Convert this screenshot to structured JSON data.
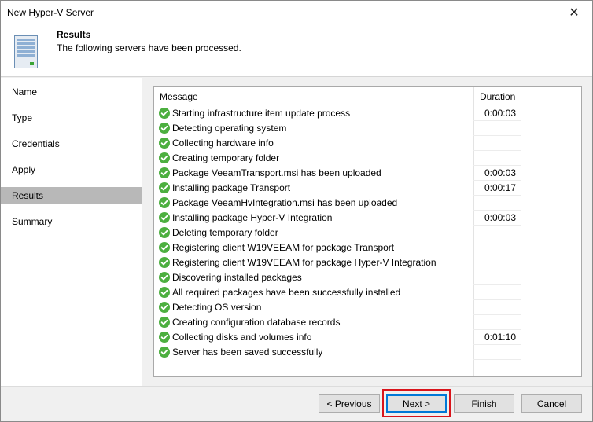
{
  "window": {
    "title": "New Hyper-V Server",
    "close_glyph": "✕"
  },
  "header": {
    "icon": "server-icon",
    "title": "Results",
    "subtitle": "The following servers have been processed."
  },
  "sidebar": {
    "items": [
      {
        "label": "Name",
        "active": false
      },
      {
        "label": "Type",
        "active": false
      },
      {
        "label": "Credentials",
        "active": false
      },
      {
        "label": "Apply",
        "active": false
      },
      {
        "label": "Results",
        "active": true
      },
      {
        "label": "Summary",
        "active": false
      }
    ]
  },
  "table": {
    "headers": {
      "message": "Message",
      "duration": "Duration"
    },
    "status_icon": "check-circle-icon",
    "status_color": "#4caf3f",
    "rows": [
      {
        "message": "Starting infrastructure item update process",
        "duration": "0:00:03"
      },
      {
        "message": "Detecting operating system",
        "duration": ""
      },
      {
        "message": "Collecting hardware info",
        "duration": ""
      },
      {
        "message": "Creating temporary folder",
        "duration": ""
      },
      {
        "message": "Package VeeamTransport.msi has been uploaded",
        "duration": "0:00:03"
      },
      {
        "message": "Installing package Transport",
        "duration": "0:00:17"
      },
      {
        "message": "Package VeeamHvIntegration.msi has been uploaded",
        "duration": ""
      },
      {
        "message": "Installing package Hyper-V Integration",
        "duration": "0:00:03"
      },
      {
        "message": "Deleting temporary folder",
        "duration": ""
      },
      {
        "message": "Registering client W19VEEAM for package Transport",
        "duration": ""
      },
      {
        "message": "Registering client W19VEEAM for package Hyper-V Integration",
        "duration": ""
      },
      {
        "message": "Discovering installed packages",
        "duration": ""
      },
      {
        "message": "All required packages have been successfully installed",
        "duration": ""
      },
      {
        "message": "Detecting OS version",
        "duration": ""
      },
      {
        "message": "Creating configuration database records",
        "duration": ""
      },
      {
        "message": "Collecting disks and volumes info",
        "duration": "0:01:10"
      },
      {
        "message": "Server has been saved successfully",
        "duration": ""
      }
    ]
  },
  "buttons": {
    "previous": "< Previous",
    "next": "Next >",
    "finish": "Finish",
    "cancel": "Cancel"
  },
  "colors": {
    "focus_highlight": "#d9141b",
    "primary_border": "#0078d7"
  }
}
